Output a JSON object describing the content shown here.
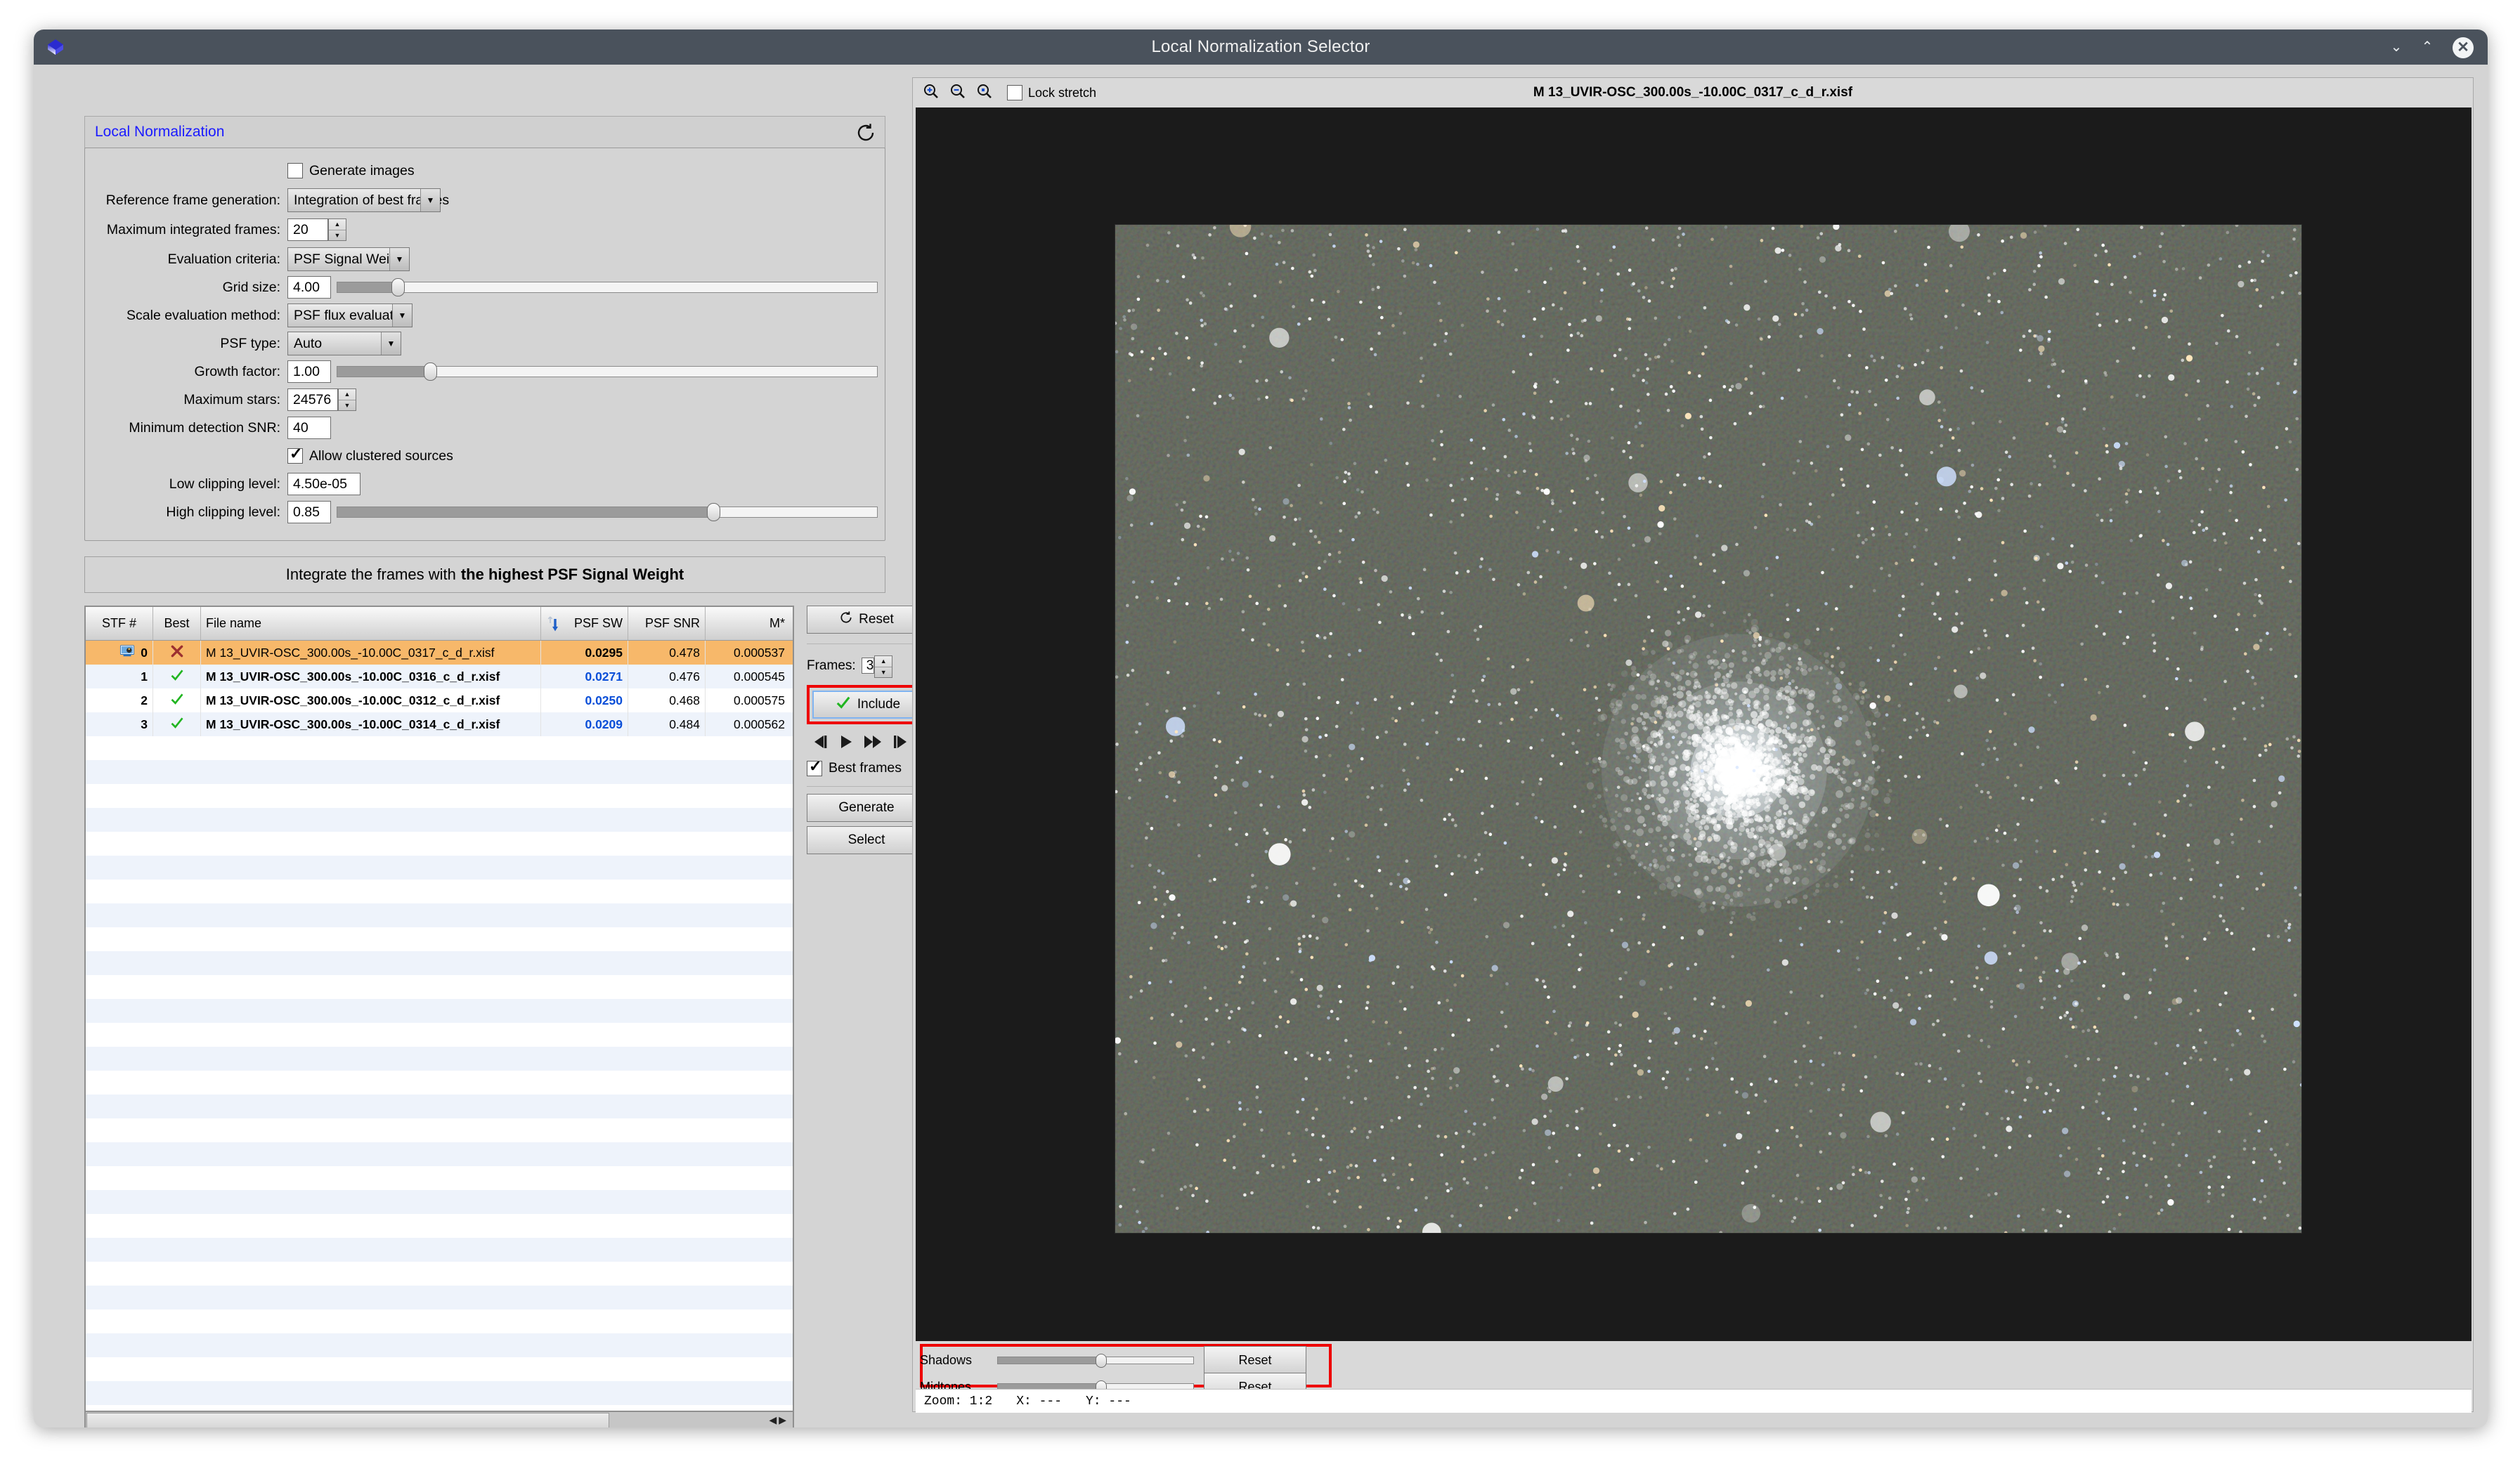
{
  "window": {
    "title": "Local Normalization Selector",
    "icon": "pixinsight-cube-icon",
    "minimize_label": "⌄",
    "maximize_label": "⌃",
    "close_label": "✕"
  },
  "local_normalization": {
    "header_title": "Local Normalization",
    "reset_icon": "reset-icon",
    "generate_images": {
      "label": "Generate images",
      "checked": false
    },
    "reference_frame_generation": {
      "label": "Reference frame generation:",
      "value": "Integration of best frames"
    },
    "maximum_integrated_frames": {
      "label": "Maximum integrated frames:",
      "value": "20"
    },
    "evaluation_criteria": {
      "label": "Evaluation criteria:",
      "value": "PSF Signal Weight"
    },
    "grid_size": {
      "label": "Grid size:",
      "value": "4.00",
      "slider_pct": 12
    },
    "scale_evaluation_method": {
      "label": "Scale evaluation method:",
      "value": "PSF flux evaluation"
    },
    "psf_type": {
      "label": "PSF type:",
      "value": "Auto"
    },
    "growth_factor": {
      "label": "Growth factor:",
      "value": "1.00",
      "slider_pct": 18
    },
    "maximum_stars": {
      "label": "Maximum stars:",
      "value": "24576"
    },
    "minimum_detection_snr": {
      "label": "Minimum detection SNR:",
      "value": "40"
    },
    "allow_clustered_sources": {
      "label": "Allow clustered sources",
      "checked": true
    },
    "low_clipping_level": {
      "label": "Low clipping level:",
      "value": "4.50e-05"
    },
    "high_clipping_level": {
      "label": "High clipping level:",
      "value": "0.85",
      "slider_pct": 70
    }
  },
  "integrate_banner": {
    "prefix": "Integrate the frames with",
    "emphasis": "the highest PSF Signal Weight"
  },
  "table": {
    "columns": [
      "STF #",
      "Best",
      "File name",
      "PSF SW",
      "PSF SNR",
      "M*"
    ],
    "sort_column": "PSF SW",
    "sort_direction": "descending",
    "rows": [
      {
        "stf": "0",
        "best": "x",
        "file": "M 13_UVIR-OSC_300.00s_-10.00C_0317_c_d_r.xisf",
        "psf_sw": "0.0295",
        "psf_snr": "0.478",
        "mstar": "0.000537",
        "selected": true,
        "has_stf_icon": true
      },
      {
        "stf": "1",
        "best": "check",
        "file": "M 13_UVIR-OSC_300.00s_-10.00C_0316_c_d_r.xisf",
        "psf_sw": "0.0271",
        "psf_snr": "0.476",
        "mstar": "0.000545",
        "selected": false,
        "has_stf_icon": false
      },
      {
        "stf": "2",
        "best": "check",
        "file": "M 13_UVIR-OSC_300.00s_-10.00C_0312_c_d_r.xisf",
        "psf_sw": "0.0250",
        "psf_snr": "0.468",
        "mstar": "0.000575",
        "selected": false,
        "has_stf_icon": false
      },
      {
        "stf": "3",
        "best": "check",
        "file": "M 13_UVIR-OSC_300.00s_-10.00C_0314_c_d_r.xisf",
        "psf_sw": "0.0209",
        "psf_snr": "0.484",
        "mstar": "0.000562",
        "selected": false,
        "has_stf_icon": false
      }
    ]
  },
  "side_controls": {
    "reset_label": "Reset",
    "reset_icon": "reset-icon",
    "frames_label": "Frames:",
    "frames_value": "3",
    "include_label": "Include",
    "include_icon": "green-check-icon",
    "include_highlight_color": "#ee0000",
    "nav_first_icon": "skip-back-icon",
    "nav_play_icon": "play-icon",
    "nav_fast_icon": "fast-forward-icon",
    "nav_last_icon": "skip-forward-icon",
    "best_frames": {
      "label": "Best frames",
      "checked": true
    },
    "generate_label": "Generate",
    "select_label": "Select"
  },
  "viewer": {
    "zoom_in_icon": "zoom-in-icon",
    "zoom_out_icon": "zoom-out-icon",
    "zoom_fit_icon": "zoom-fit-icon",
    "lock_stretch": {
      "label": "Lock stretch",
      "checked": false
    },
    "filename": "M 13_UVIR-OSC_300.00s_-10.00C_0317_c_d_r.xisf",
    "image_subject": "M 13 globular cluster"
  },
  "stf_controls": {
    "highlight_color": "#ee0000",
    "shadows": {
      "label": "Shadows",
      "slider_pct": 52,
      "reset_label": "Reset"
    },
    "midtones": {
      "label": "Midtones",
      "slider_pct": 52,
      "reset_label": "Reset"
    }
  },
  "statusbar": {
    "zoom": "Zoom: 1:2",
    "x": "X: ---",
    "y": "Y: ---"
  }
}
